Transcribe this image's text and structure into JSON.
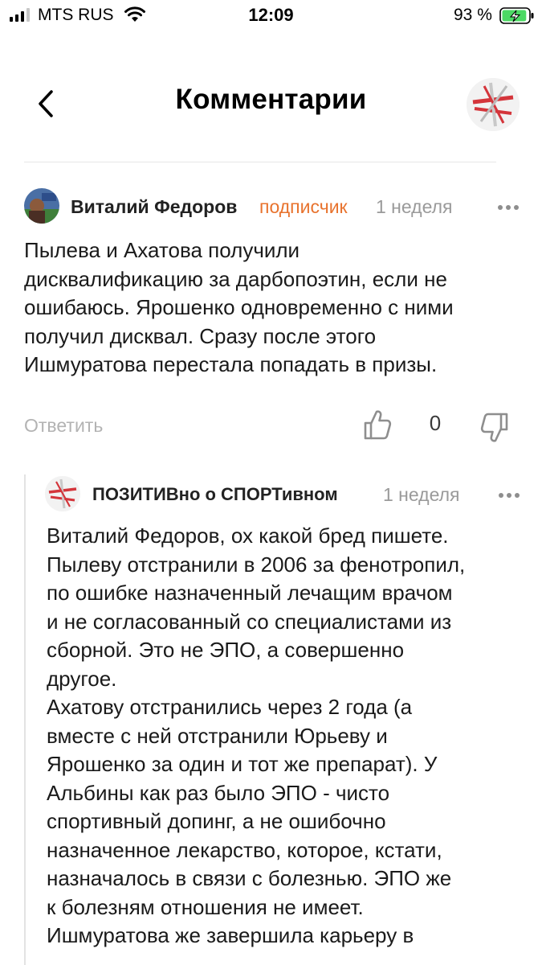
{
  "status_bar": {
    "carrier": "MTS RUS",
    "time": "12:09",
    "battery_percent": "93 %",
    "battery_level": 0.93,
    "battery_color": "#4cd964",
    "icons": [
      "signal-icon",
      "wifi-icon",
      "battery-charging-icon"
    ]
  },
  "header": {
    "title": "Комментарии",
    "back_icon": "chevron-left-icon"
  },
  "comment": {
    "author": "Виталий Федоров",
    "badge": "подписчик",
    "time": "1 неделя",
    "text": "Пылева и Ахатова получили\nдисквалификацию за дарбопоэтин, если не\nошибаюсь. Ярошенко одновременно с ними\nполучил дисквал. Сразу после этого\nИшмуратова перестала попадать в призы.",
    "reply_label": "Ответить",
    "likes": "0",
    "badge_color": "#e8732e"
  },
  "reply": {
    "author": "ПОЗИТИВно о СПОРТивном",
    "time": "1 неделя",
    "text": "Виталий Федоров, ох какой бред пишете.\nПылеву отстранили в 2006 за фенотропил,\nпо ошибке назначенный лечащим врачом\nи не согласованный со специалистами из\nсборной. Это не ЭПО, а совершенно\nдругое.\nАхатову отстранились через 2 года (а\nвместе с ней отстранили Юрьеву и\nЯрошенко за один и тот же препарат). У\nАльбины как раз было ЭПО - чисто\nспортивный допинг, а не ошибочно\nназначенное лекарство, которое, кстати,\nназначалось в связи с болезнью. ЭПО же\nк болезням отношения не имеет.\nИшмуратова же завершила карьеру в"
  }
}
